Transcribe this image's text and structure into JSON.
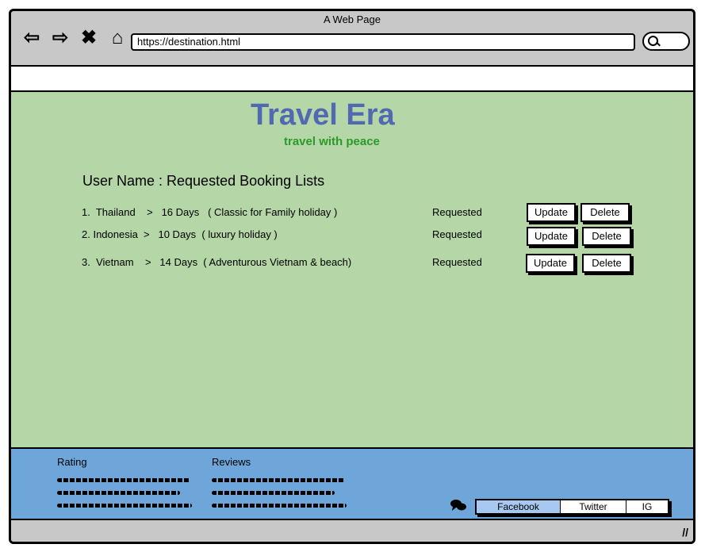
{
  "window": {
    "title": "A Web Page"
  },
  "browser": {
    "nav_icons": [
      "back-arrow-icon",
      "forward-arrow-icon",
      "close-icon",
      "home-icon"
    ],
    "address": "https://destination.html"
  },
  "site": {
    "brand": "Travel Era",
    "tagline": "travel with peace"
  },
  "bookings": {
    "heading": "User Name :  Requested Booking Lists",
    "items": [
      {
        "text": "1.  Thailand    >   16 Days   ( Classic for Family holiday )",
        "status": "Requested",
        "update": "Update",
        "delete": "Delete"
      },
      {
        "text": "2. Indonesia  >   10 Days  ( luxury holiday )",
        "status": "Requested",
        "update": "Update",
        "delete": "Delete"
      },
      {
        "text": "3.  Vietnam    >   14 Days  ( Adventurous Vietnam & beach)",
        "status": "Requested",
        "update": "Update",
        "delete": "Delete"
      }
    ]
  },
  "footer": {
    "rating_title": "Rating",
    "reviews_title": "Reviews",
    "social": [
      "Facebook",
      "Twitter",
      "IG"
    ]
  },
  "colors": {
    "main_bg": "#b5d6a6",
    "brand": "#5169b0",
    "tagline": "#2a9a2a",
    "footer_bg": "#6fa6d9",
    "active_tab": "#a7c8f0"
  }
}
